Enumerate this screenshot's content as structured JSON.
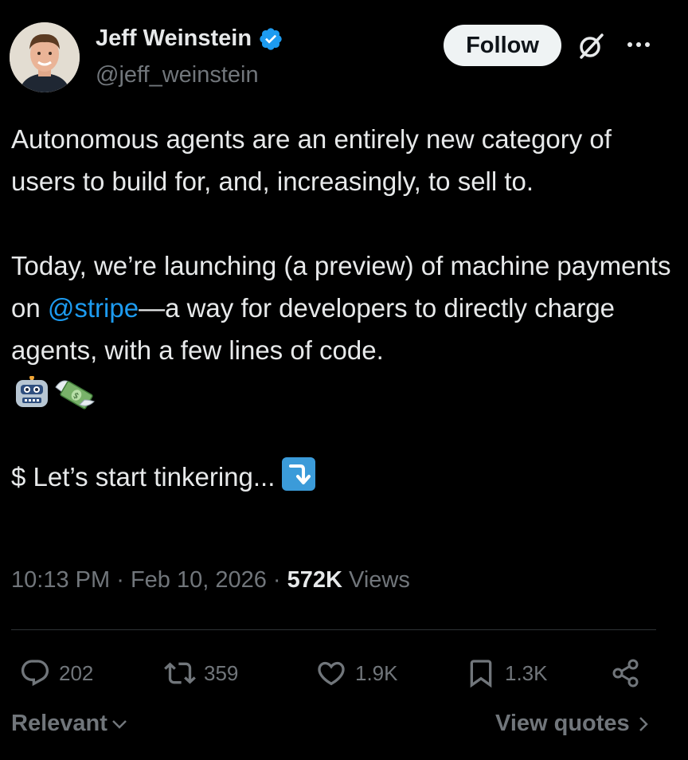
{
  "author": {
    "name": "Jeff Weinstein",
    "handle": "@jeff_weinstein",
    "verified": true
  },
  "header": {
    "follow_label": "Follow",
    "icons": [
      "grok-icon",
      "more-icon"
    ]
  },
  "tweet": {
    "para1": "Autonomous agents are an entirely new category of users to build for, and, increasingly, to sell to.",
    "para2_prefix": "Today, we’re launching (a preview) of machine payments on ",
    "mention": "@stripe",
    "para2_suffix": "—a way for developers to directly charge agents, with a few lines of code.",
    "emojis": [
      "robot-face-emoji",
      "money-with-wings-emoji"
    ],
    "para3": "$ Let’s start tinkering...",
    "para3_emoji": "right-arrow-curving-down-emoji"
  },
  "meta": {
    "time": "10:13 PM",
    "sep1": "·",
    "date": "Feb 10, 2026",
    "sep2": "·",
    "views_count": "572K",
    "views_label": "Views"
  },
  "actions": {
    "replies": "202",
    "reposts": "359",
    "likes": "1.9K",
    "bookmarks": "1.3K"
  },
  "footer": {
    "sort_label": "Relevant",
    "quotes_label": "View quotes"
  },
  "colors": {
    "background": "#000000",
    "text": "#e7e9ea",
    "muted": "#71767b",
    "link": "#1d9bf0",
    "follow_bg": "#eff3f4"
  }
}
